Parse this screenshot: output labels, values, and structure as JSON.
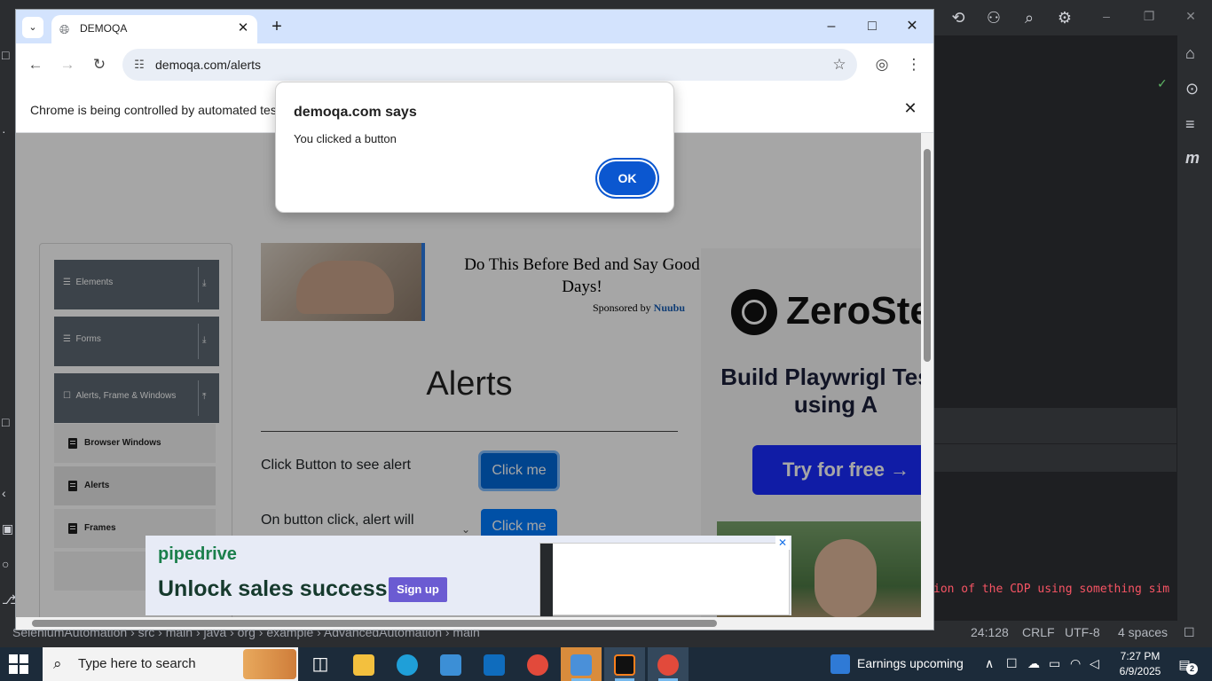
{
  "browser": {
    "tab_title": "DEMOQA",
    "url": "demoqa.com/alerts",
    "infobar_message": "Chrome is being controlled by automated test software."
  },
  "alert": {
    "title": "demoqa.com says",
    "message": "You clicked a button",
    "ok_label": "OK"
  },
  "sidebar": {
    "groups": [
      {
        "label": "Elements"
      },
      {
        "label": "Forms"
      },
      {
        "label": "Alerts, Frame & Windows"
      }
    ],
    "items": [
      {
        "label": "Browser Windows",
        "active": false
      },
      {
        "label": "Alerts",
        "active": true
      },
      {
        "label": "Frames",
        "active": false
      }
    ]
  },
  "ad_top": {
    "headline": "Do This Before Bed and Say Good Days!",
    "sponsor_prefix": "Sponsored by",
    "sponsor_name": "Nuubu"
  },
  "main": {
    "title": "Alerts",
    "rows": [
      {
        "label": "Click Button to see alert",
        "button": "Click me"
      },
      {
        "label": "On button click, alert will",
        "button": "Click me"
      }
    ]
  },
  "ad_right": {
    "brand": "ZeroSte",
    "tagline": "Build Playwrigl Tests using A",
    "cta": "Try for free →"
  },
  "ad_bottom": {
    "brand": "pipedrive",
    "headline": "Unlock sales success",
    "cta": "Sign up"
  },
  "ide": {
    "console_text": "ion of the CDP using something sim",
    "breadcrumb": "SeleniumAutomation  ›  src  ›  main  ›  java  ›  org  ›  example  ›  AdvancedAutomation  ›  main",
    "cursor_pos": "24:128",
    "line_sep": "CRLF",
    "encoding": "UTF-8",
    "indent": "4 spaces"
  },
  "taskbar": {
    "search_placeholder": "Type here to search",
    "news": "Earnings upcoming",
    "time": "7:27 PM",
    "date": "6/9/2025",
    "notification_count": "2"
  }
}
